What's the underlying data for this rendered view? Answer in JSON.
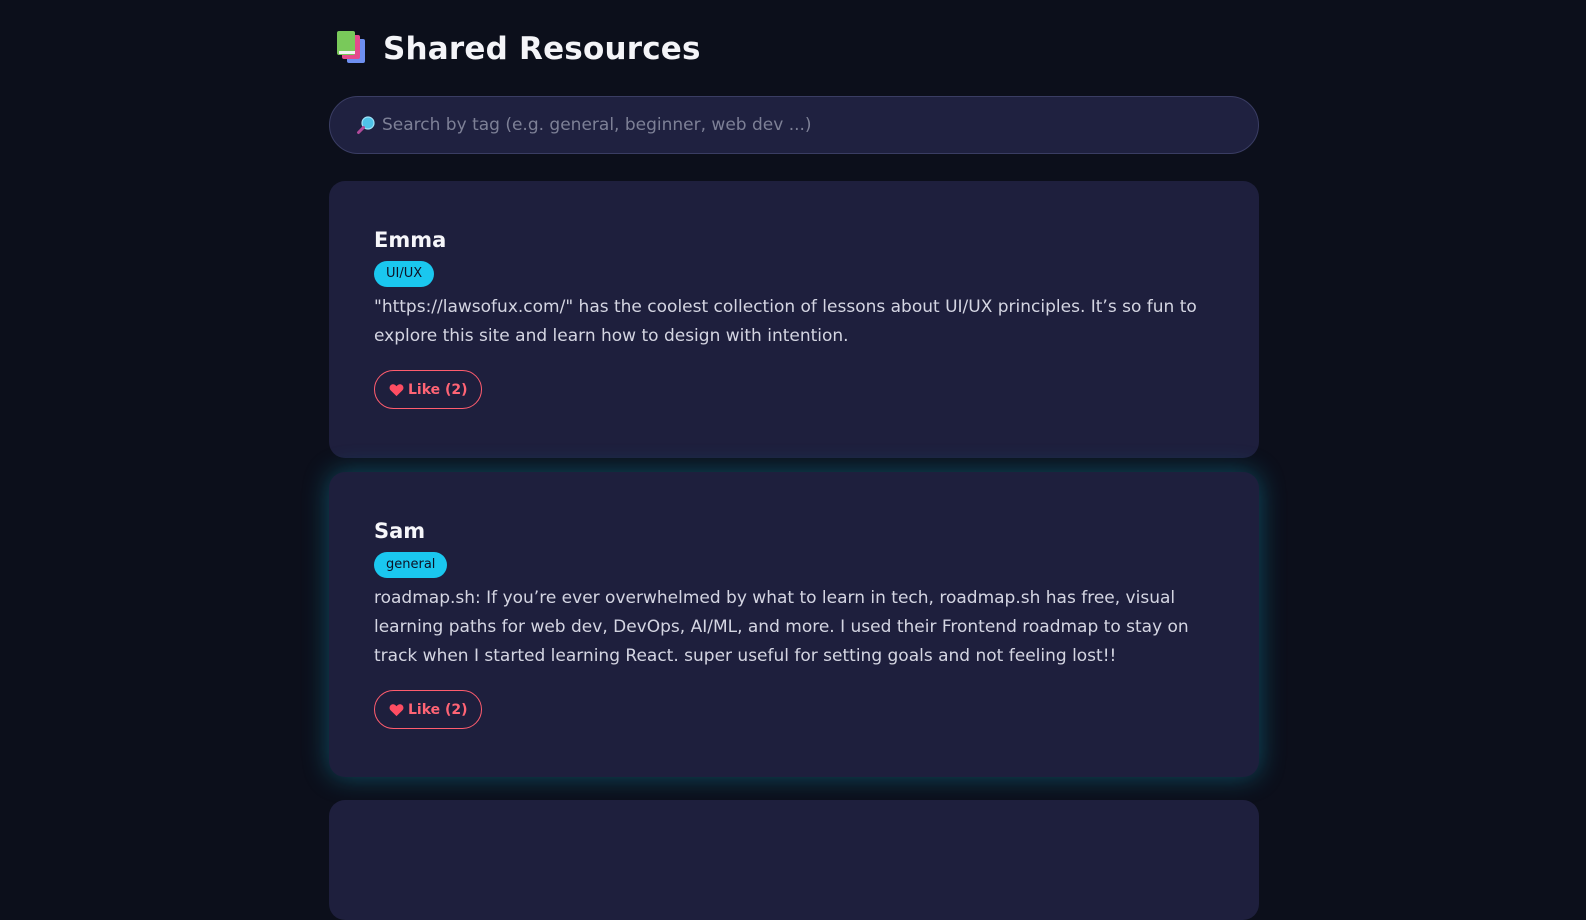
{
  "header": {
    "icon": "books-icon",
    "title": "Shared Resources"
  },
  "search": {
    "icon": "magnifier-icon",
    "placeholder": "Search by tag (e.g. general, beginner, web dev ...)",
    "value": ""
  },
  "posts": [
    {
      "author": "Emma",
      "tag": "UI/UX",
      "text": "\"https://lawsofux.com/\" has the coolest collection of lessons about UI/UX principles. It’s so fun to explore this site and learn how to design with intention.",
      "like_label": "Like (2)"
    },
    {
      "author": "Sam",
      "tag": "general",
      "text": "roadmap.sh: If you’re ever overwhelmed by what to learn in tech, roadmap.sh has free, visual learning paths for web dev, DevOps, AI/ML, and more. I used their Frontend roadmap to stay on track when I started learning React. super useful for setting goals and not feeling lost!!",
      "like_label": "Like (2)"
    }
  ],
  "colors": {
    "background": "#0c0f1b",
    "card": "#1e1f3d",
    "tag": "#1ac7ef",
    "like": "#ff5c6e",
    "glow": "#11a4c4"
  }
}
